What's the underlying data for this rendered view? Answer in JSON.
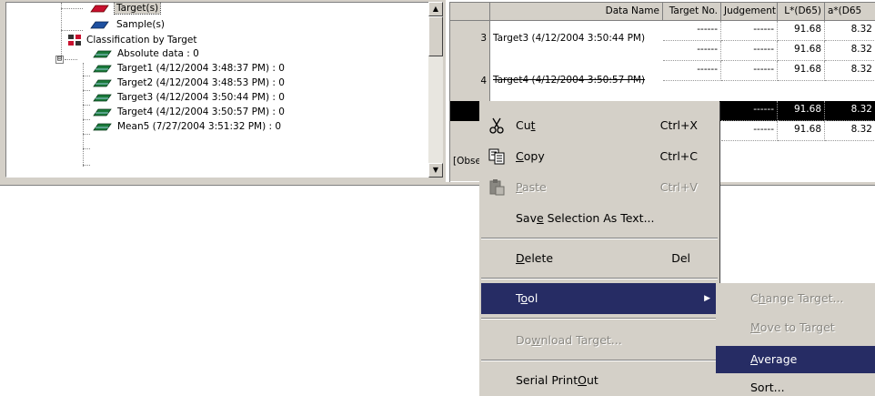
{
  "tree": {
    "items": [
      {
        "label": "Target(s)",
        "icon": "target-icon"
      },
      {
        "label": "Sample(s)",
        "icon": "sample-icon"
      },
      {
        "label": "Classification by Target",
        "icon": "classification-icon"
      },
      {
        "label": "Absolute data : 0",
        "icon": "data-icon"
      },
      {
        "label": "Target1 (4/12/2004 3:48:37 PM) : 0",
        "icon": "data-icon"
      },
      {
        "label": "Target2 (4/12/2004 3:48:53 PM) : 0",
        "icon": "data-icon"
      },
      {
        "label": "Target3 (4/12/2004 3:50:44 PM) : 0",
        "icon": "data-icon"
      },
      {
        "label": "Target4 (4/12/2004 3:50:57 PM) : 0",
        "icon": "data-icon"
      },
      {
        "label": "Mean5 (7/27/2004 3:51:32 PM) : 0",
        "icon": "data-icon"
      }
    ],
    "expander": "⊟"
  },
  "grid": {
    "columns": [
      "Data Name",
      "Target No.",
      "Judgement",
      "L*(D65)",
      "a*(D65"
    ],
    "rows": [
      {
        "num": "3",
        "name": "Target3 (4/12/2004 3:50:44 PM)",
        "target_no": "------",
        "judgement": "------",
        "L": "91.68",
        "a": "8.32"
      },
      {
        "num": "",
        "name": "",
        "target_no": "------",
        "judgement": "------",
        "L": "91.68",
        "a": "8.32"
      },
      {
        "num": "4",
        "name": "Target4 (4/12/2004 3:50:57 PM)",
        "target_no": "------",
        "judgement": "------",
        "L": "91.68",
        "a": "8.32"
      },
      {
        "num": "",
        "name": "",
        "target_no": "",
        "judgement": "------",
        "L": "91.68",
        "a": "8.32"
      },
      {
        "num": "",
        "name": "",
        "target_no": "",
        "judgement": "------",
        "L": "91.68",
        "a": "8.32"
      }
    ],
    "obs_label": "[Obse"
  },
  "context_menu": {
    "items": [
      {
        "pre": "Cu",
        "key": "t",
        "post": "",
        "shortcut": "Ctrl+X"
      },
      {
        "pre": "",
        "key": "C",
        "post": "opy",
        "shortcut": "Ctrl+C"
      },
      {
        "pre": "",
        "key": "P",
        "post": "aste",
        "shortcut": "Ctrl+V"
      },
      {
        "pre": "Sav",
        "key": "e",
        "post": " Selection As Text...",
        "shortcut": ""
      },
      {
        "pre": "",
        "key": "D",
        "post": "elete",
        "shortcut": "Del"
      },
      {
        "pre": "T",
        "key": "o",
        "post": "ol",
        "shortcut": ""
      },
      {
        "pre": "Do",
        "key": "w",
        "post": "nload Target...",
        "shortcut": ""
      },
      {
        "pre": "Serial Print",
        "key": "O",
        "post": "ut",
        "shortcut": ""
      }
    ]
  },
  "submenu": {
    "items": [
      {
        "pre": "C",
        "key": "h",
        "post": "ange Target..."
      },
      {
        "pre": "",
        "key": "M",
        "post": "ove to Target"
      },
      {
        "pre": "",
        "key": "A",
        "post": "verage"
      },
      {
        "pre": "Sort",
        "key": "",
        "post": "..."
      }
    ]
  },
  "colors": {
    "face": "#d4d0c8",
    "highlight": "#262c64",
    "selected_row": "#000000",
    "disabled_text": "#8a8882"
  }
}
